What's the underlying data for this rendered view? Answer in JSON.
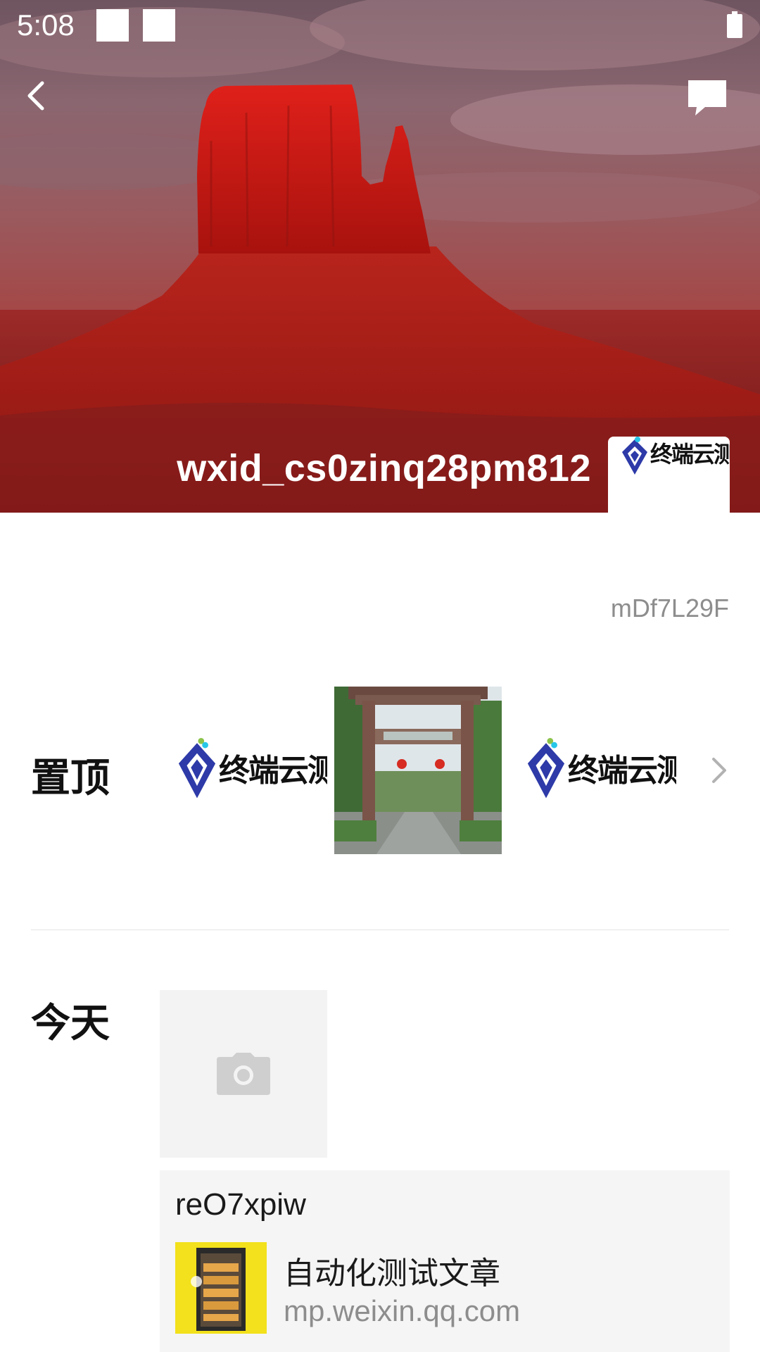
{
  "status_bar": {
    "time": "5:08",
    "battery_icon": "battery-icon"
  },
  "header": {
    "back_icon": "chevron-left-icon",
    "comment_icon": "comment-icon",
    "username": "wxid_cs0zinq28pm812"
  },
  "profile": {
    "signature": "mDf7L29F",
    "avatar_logo_text": "终端云测"
  },
  "pinned": {
    "label": "置顶",
    "items": [
      {
        "kind": "logo",
        "text": "终端云测"
      },
      {
        "kind": "photo",
        "subject": "stone-gate-photo"
      },
      {
        "kind": "logo",
        "text": "终端云测"
      }
    ],
    "more_icon": "chevron-right-icon"
  },
  "timeline": {
    "day_label": "今天",
    "placeholder_icon": "camera-icon",
    "share": {
      "user": "reO7xpiw",
      "title": "自动化测试文章",
      "domain": "mp.weixin.qq.com"
    }
  },
  "colors": {
    "logo_blue": "#2d3aa8",
    "logo_cyan": "#26c6e8",
    "logo_green": "#8bc34a",
    "thumbnail_yellow": "#f2e11c"
  }
}
